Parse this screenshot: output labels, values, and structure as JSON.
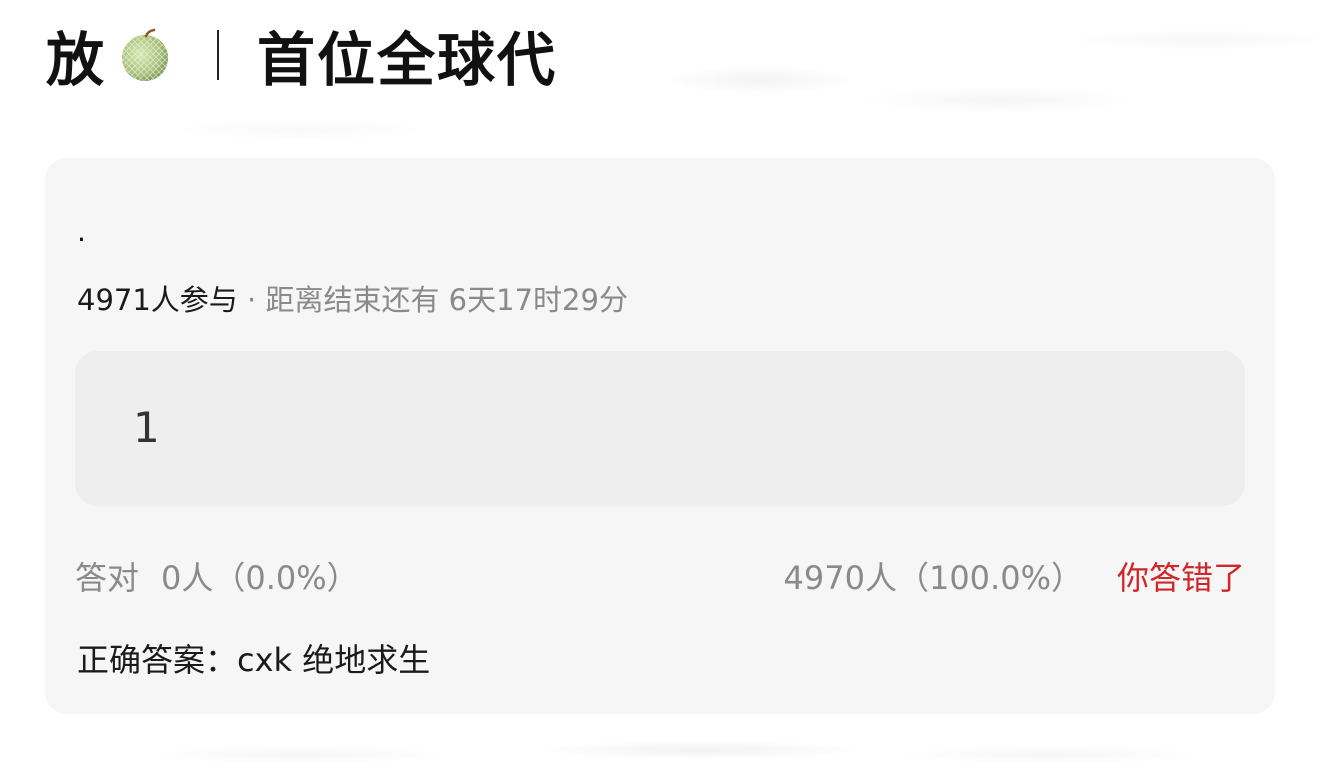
{
  "header": {
    "title_left": "放",
    "melon_icon": "melon-emoji",
    "title_right": "首位全球代"
  },
  "poll": {
    "question": "·",
    "participants": "4971人参与",
    "separator": "·",
    "deadline": "距离结束还有 6天17时29分",
    "option_label": "1",
    "correct_label": "答对",
    "correct_stats": "0人（0.0%）",
    "wrong_stats": "4970人（100.0%）",
    "result_text": "你答错了",
    "answer_text": "正确答案：cxk 绝地求生"
  },
  "colors": {
    "accent_red": "#d0282a",
    "muted_gray": "#8a8a8a",
    "card_bg": "#f6f6f6",
    "option_bg": "#eeeeee"
  }
}
